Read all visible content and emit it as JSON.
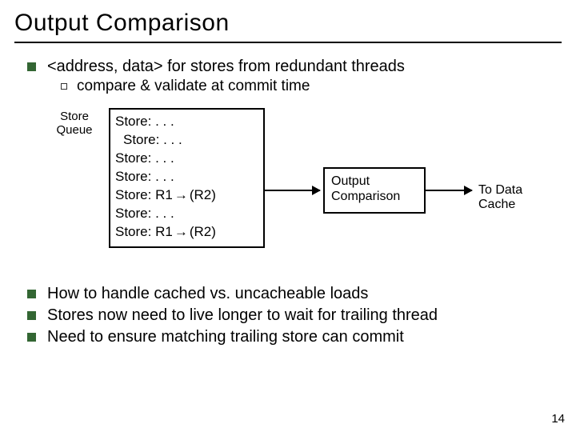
{
  "title": "Output Comparison",
  "bullets": {
    "b0": "<address, data> for stores from redundant threads",
    "sub0": "compare & validate at commit time",
    "b1": "How to handle cached vs. uncacheable loads",
    "b2": "Stores now need to live longer to wait for trailing thread",
    "b3": "Need to ensure matching trailing store can commit"
  },
  "diagram": {
    "store_queue_label_l1": "Store",
    "store_queue_label_l2": "Queue",
    "queue_rows": {
      "r0": "Store: . . .",
      "r1": "Store: . . .",
      "r2": "Store: . . .",
      "r3": "Store: . . .",
      "r4_pre": "Store: R1 ",
      "r4_post": " (R2)",
      "r5": "Store: . . .",
      "r6_pre": "Store: R1 ",
      "r6_post": " (R2)"
    },
    "arrow_symbol": "→",
    "output_comparison_l1": "Output",
    "output_comparison_l2": "Comparison",
    "to_cache": "To Data Cache"
  },
  "page_number": "14"
}
